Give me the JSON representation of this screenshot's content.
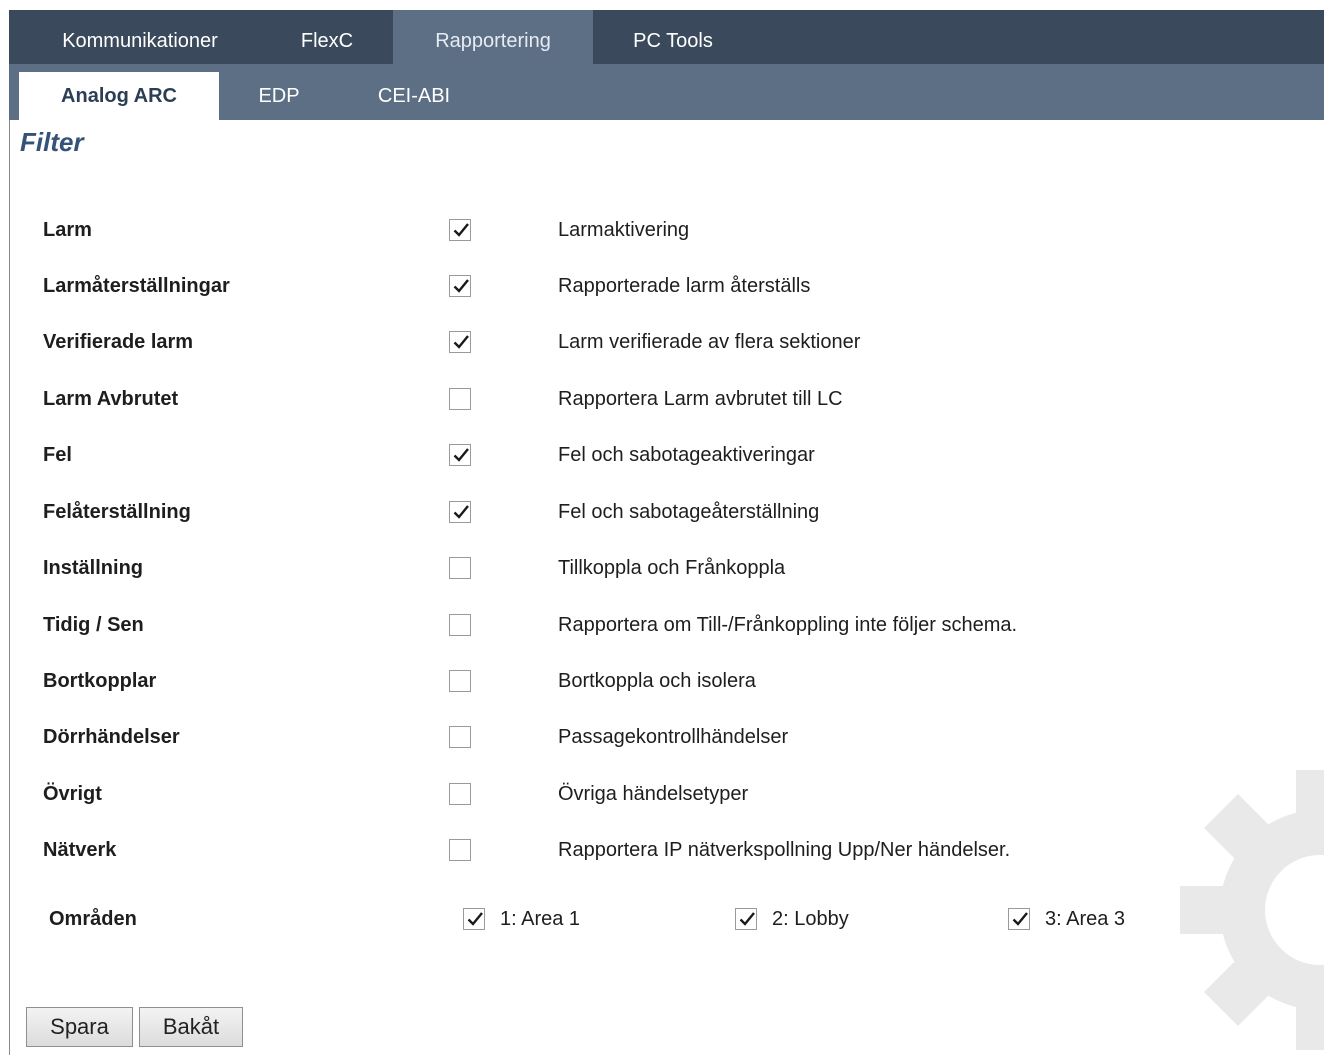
{
  "tabs_top": [
    {
      "label": "Kommunikationer",
      "active": false
    },
    {
      "label": "FlexC",
      "active": false
    },
    {
      "label": "Rapportering",
      "active": true
    },
    {
      "label": "PC Tools",
      "active": false
    }
  ],
  "tabs_sub": [
    {
      "label": "Analog ARC",
      "active": true
    },
    {
      "label": "EDP",
      "active": false
    },
    {
      "label": "CEI-ABI",
      "active": false
    }
  ],
  "section_title": "Filter",
  "filters": [
    {
      "label": "Larm",
      "checked": true,
      "description": "Larmaktivering"
    },
    {
      "label": "Larmåterställningar",
      "checked": true,
      "description": "Rapporterade larm återställs"
    },
    {
      "label": "Verifierade larm",
      "checked": true,
      "description": "Larm verifierade av flera sektioner"
    },
    {
      "label": "Larm Avbrutet",
      "checked": false,
      "description": "Rapportera Larm avbrutet till LC"
    },
    {
      "label": "Fel",
      "checked": true,
      "description": "Fel och sabotageaktiveringar"
    },
    {
      "label": "Felåterställning",
      "checked": true,
      "description": "Fel och sabotageåterställning"
    },
    {
      "label": "Inställning",
      "checked": false,
      "description": "Tillkoppla och Frånkoppla"
    },
    {
      "label": "Tidig / Sen",
      "checked": false,
      "description": "Rapportera om Till-/Frånkoppling inte följer schema."
    },
    {
      "label": "Bortkopplar",
      "checked": false,
      "description": "Bortkoppla och isolera"
    },
    {
      "label": "Dörrhändelser",
      "checked": false,
      "description": "Passagekontrollhändelser"
    },
    {
      "label": "Övrigt",
      "checked": false,
      "description": "Övriga händelsetyper"
    },
    {
      "label": "Nätverk",
      "checked": false,
      "description": "Rapportera IP nätverkspollning Upp/Ner händelser."
    }
  ],
  "areas": {
    "label": "Områden",
    "items": [
      {
        "label": "1: Area 1",
        "checked": true
      },
      {
        "label": "2: Lobby",
        "checked": true
      },
      {
        "label": "3: Area 3",
        "checked": true
      }
    ]
  },
  "buttons": {
    "save": "Spara",
    "back": "Bakåt"
  },
  "colors": {
    "tabbar_top": "#3a4a5c",
    "tabbar_sub": "#5c6f85",
    "title": "#355277"
  }
}
